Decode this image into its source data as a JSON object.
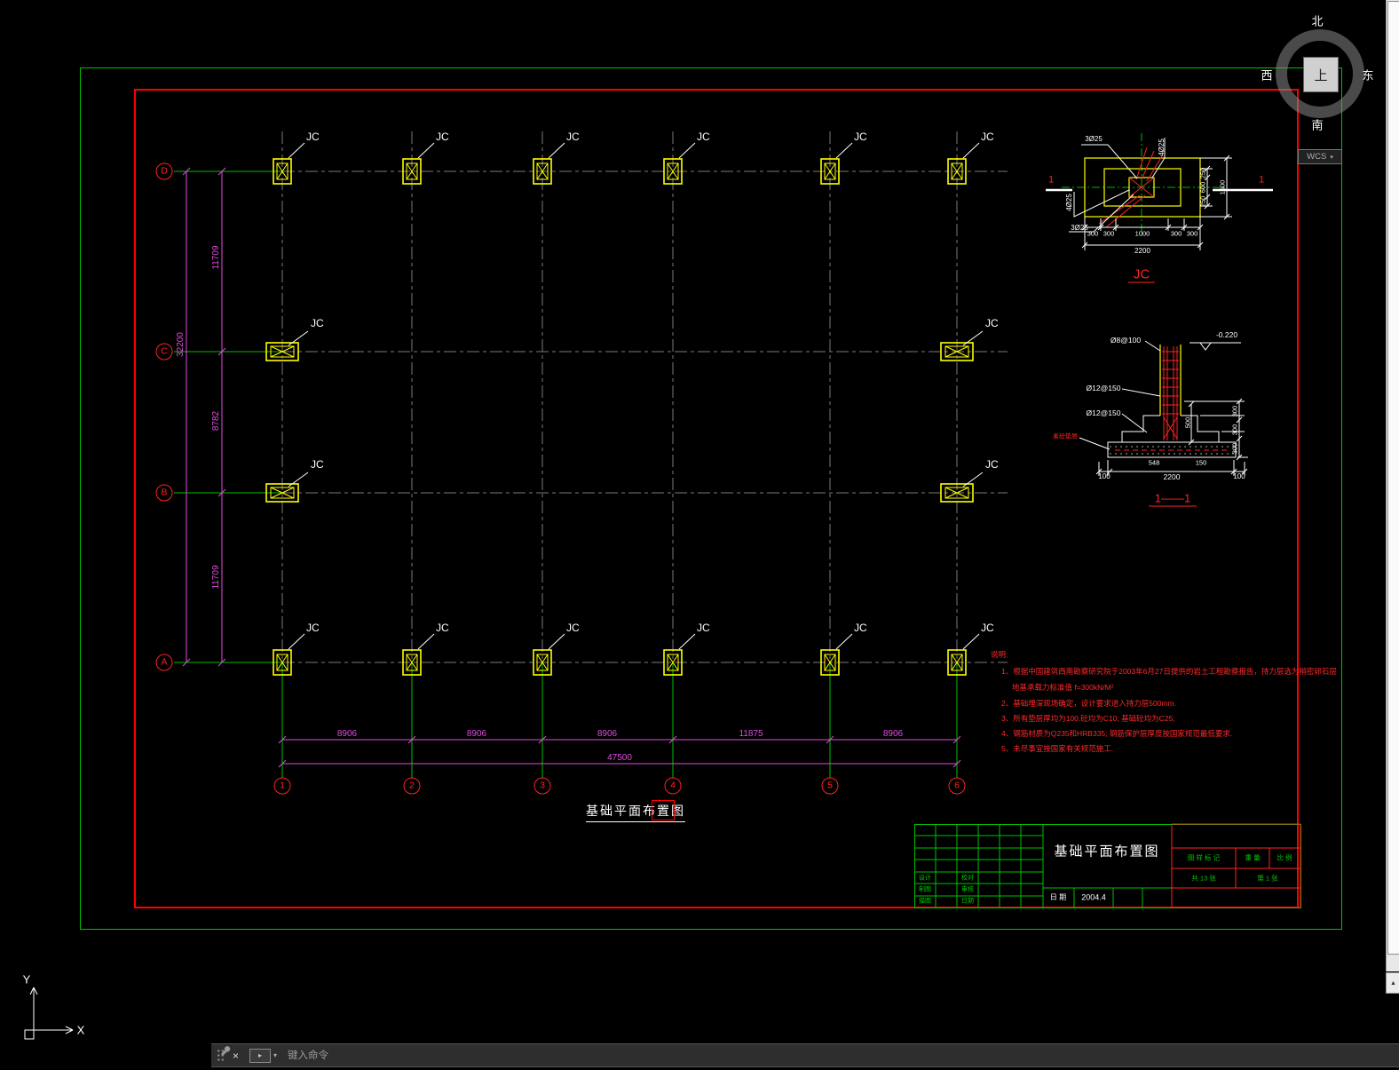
{
  "nav": {
    "north": "北",
    "west": "西",
    "east": "东",
    "south": "南",
    "top": "上",
    "wcs": "WCS"
  },
  "icons": {
    "close": "×",
    "caret_down": "▾",
    "arrow_up": "▲",
    "prompt": "▸"
  },
  "ucs": {
    "x": "X",
    "y": "Y"
  },
  "command_bar": {
    "placeholder": "键入命令"
  },
  "plan": {
    "title": "基础平面布置图",
    "jc": "JC",
    "rows": [
      "D",
      "C",
      "B",
      "A"
    ],
    "cols": [
      "1",
      "2",
      "3",
      "4",
      "5",
      "6"
    ],
    "vdims": [
      "11709",
      "8782",
      "11709"
    ],
    "vtotal": "32200",
    "hdims": [
      "8906",
      "8906",
      "8906",
      "11875",
      "8906"
    ],
    "htotal": "47500"
  },
  "jc_detail": {
    "label": "JC",
    "bar_tl": "3Ø25",
    "bar_tr": "4Ø25",
    "bar_l": "4Ø25",
    "bar_bl": "3Ø25",
    "right_dims": [
      "250",
      "600",
      "250"
    ],
    "right_total": "1600",
    "bottom_dims": [
      "300",
      "300",
      "1000",
      "300",
      "300"
    ],
    "bottom_total": "2200",
    "section_no": "1"
  },
  "section_detail": {
    "label": "1——1",
    "tie": "Ø8@100",
    "level": "-0.220",
    "bar1": "Ø12@150",
    "bar2": "Ø12@150",
    "dim_500": "500",
    "right_dims": [
      "300",
      "300",
      "300"
    ],
    "pad_label": "素砼垫层",
    "bottom_left": "100",
    "bottom_mid": "2200",
    "bottom_right": "100",
    "dim_548": "548",
    "dim_150": "150"
  },
  "notes": {
    "title": "说明:",
    "lines": [
      "1、根据中国建筑西南勘察研究院于2003年6月27日提供的岩土工程勘察报告，持力层选为稍密卵石层",
      "地基承载力标准值 f=300kN/M²",
      "2、基础埋深现场确定，设计要求进入持力层500mm.",
      "3、所有垫层厚均为100,砼均为C10; 基础砼均为C25;",
      "4、钢筋材质为Q235和HRB335; 钢筋保护层厚度按国家规范最低要求.",
      "5、未尽事宜按国家有关规范施工."
    ]
  },
  "titleblock": {
    "title": "基础平面布置图",
    "date_label": "日 期",
    "date_value": "2004.4",
    "left_rows": [
      [
        "设计",
        "校对"
      ],
      [
        "制图",
        "审核"
      ],
      [
        "描图",
        "日期"
      ]
    ],
    "right_header": [
      "图 样 标 记",
      "重 量",
      "比 例"
    ],
    "sheet_total": "共 13 张",
    "sheet_no": "第 1 张"
  }
}
